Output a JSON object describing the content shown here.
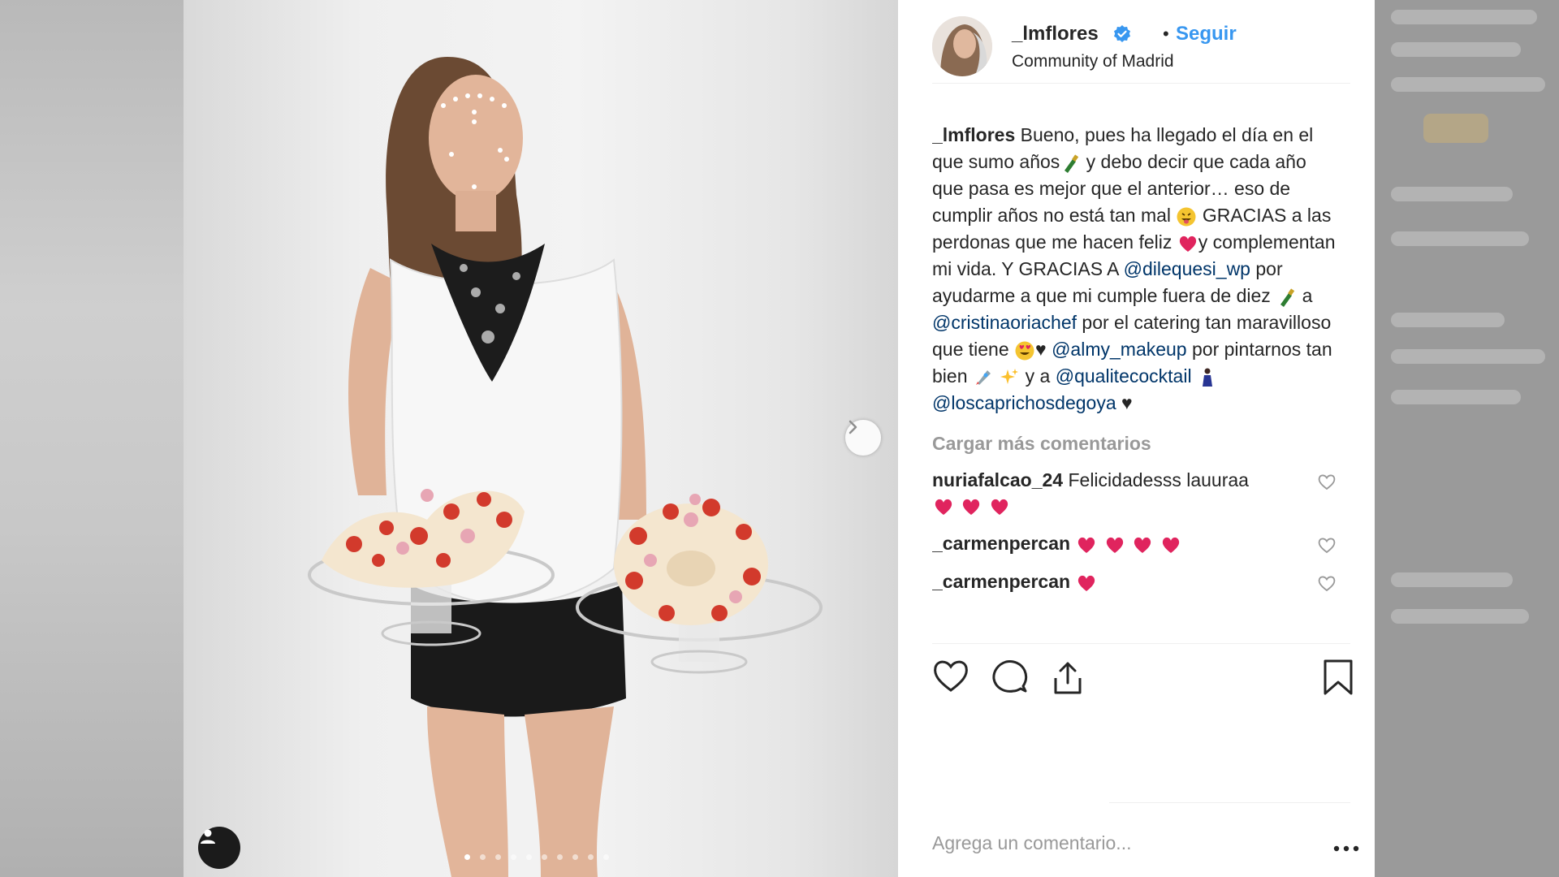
{
  "post": {
    "username": "_lmflores",
    "follow_label": "Seguir",
    "bullet": "•",
    "location": "Community of Madrid"
  },
  "caption": {
    "username": "_lmflores",
    "p1": " Bueno, pues ha llegado el día en el que sumo años",
    "p2": " y debo decir que cada año que pasa es mejor que el anterior… eso de cumplir años no está tan mal ",
    "p3": " GRACIAS a las perdonas que me hacen feliz ",
    "p4": "y complementan mi vida. Y GRACIAS A ",
    "m1": "@dilequesi_wp",
    "p5": " por ayudarme a que mi cumple fuera de diez ",
    "p6": " a ",
    "m2": "@cristinaoriachef",
    "p7": " por el catering tan maravilloso que tiene ",
    "p8": "♥ ",
    "m3": "@almy_makeup",
    "p9": " por pintarnos tan bien ",
    "p10": " y a ",
    "m4": "@qualitecocktail",
    "p11": " ",
    "m5": "@loscaprichosdegoya",
    "p12": " ♥"
  },
  "load_more_label": "Cargar más comentarios",
  "comments": [
    {
      "user": "nuriafalcao_24",
      "text": " Felicidadesss lauuraa"
    },
    {
      "user": "_carmenpercan",
      "text": ""
    },
    {
      "user": "_carmenpercan",
      "text": ""
    }
  ],
  "add_comment_placeholder": "Agrega un comentario...",
  "carousel": {
    "count": 10,
    "active": 0
  },
  "icons": {
    "next": "chevron-right-icon",
    "tag": "user-tag-icon",
    "verified": "verified-badge-icon",
    "like": "heart-icon",
    "comment": "comment-bubble-icon",
    "share": "share-icon",
    "save": "bookmark-icon",
    "more": "more-options-icon"
  },
  "colors": {
    "link": "#3897f0",
    "mention": "#003569",
    "muted": "#999999",
    "heart": "#ed4956"
  }
}
